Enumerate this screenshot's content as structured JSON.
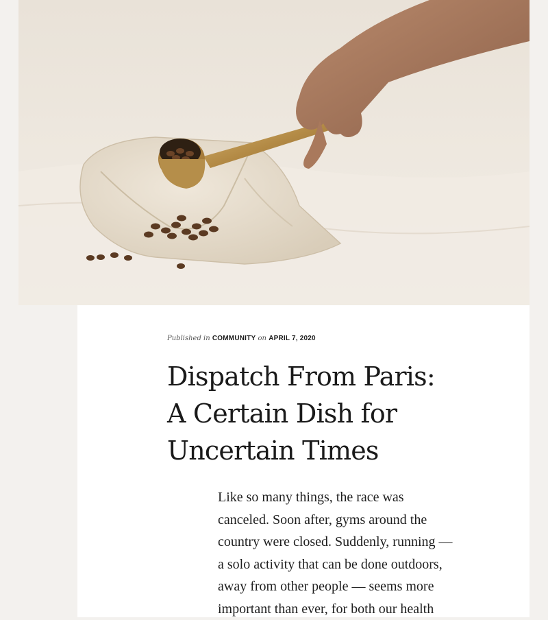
{
  "hero_image": {
    "subject": "hand-scooping-coffee-beans-photo"
  },
  "post_meta": {
    "published_prefix": "Published in",
    "category": "COMMUNITY",
    "on_word": "on",
    "date": "APRIL 7, 2020"
  },
  "post": {
    "title_line1": "Dispatch From Paris:",
    "title_line2": "A Certain Dish for",
    "title_line3": "Uncertain Times",
    "body_lines": [
      "Like so many things, the race was",
      "canceled. Soon after, gyms around the",
      "country were closed. Suddenly, running —",
      "a solo activity that can be done outdoors,",
      "away from other people — seems more",
      "important than ever, for both our health"
    ]
  },
  "colors": {
    "page_background": "#f3f1ee",
    "card_background": "#ffffff",
    "text": "#1a1a1a",
    "cloth": "#e8e0d2",
    "scoop_gold": "#b8904a",
    "beans": "#5a3a22"
  }
}
